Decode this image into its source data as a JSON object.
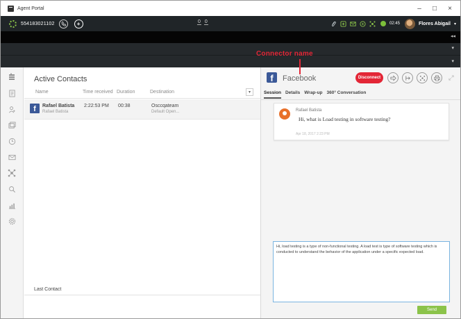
{
  "window": {
    "title": "Agent Portal",
    "controls": {
      "minimize": "–",
      "maximize": "□",
      "close": "×"
    }
  },
  "topbar": {
    "phone_number": "554183021102",
    "counter_left": "0",
    "counter_right": "0",
    "timer": "02:45",
    "user_name": "Flores Abigail",
    "status_color": "#7cbf3a"
  },
  "annotation": {
    "connector_name_label": "Connector name",
    "color": "#e32636"
  },
  "nav": {
    "items": [
      {
        "icon": "contacts-list-icon"
      },
      {
        "icon": "notes-icon"
      },
      {
        "icon": "users-icon"
      },
      {
        "icon": "directory-icon"
      },
      {
        "icon": "history-clock-icon"
      },
      {
        "icon": "mail-icon"
      },
      {
        "icon": "network-icon"
      },
      {
        "icon": "search-icon"
      },
      {
        "icon": "reports-chart-icon"
      },
      {
        "icon": "settings-gear-icon"
      }
    ]
  },
  "contacts": {
    "heading": "Active Contacts",
    "columns": {
      "name": "Name",
      "time": "Time received",
      "duration": "Duration",
      "destination": "Destination"
    },
    "rows": [
      {
        "name": "Rafael Batista",
        "sub": "Rafael Batista",
        "time": "2:22:53 PM",
        "duration": "00:38",
        "destination": "Osccqateam",
        "destination_sub": "Default Open..."
      }
    ],
    "last_contact_label": "Last Contact"
  },
  "session": {
    "connector_name": "Facebook",
    "disconnect_label": "Disconnect",
    "tabs": [
      "Session",
      "Details",
      "Wrap-up",
      "360° Conversation"
    ],
    "active_tab": "Session",
    "message": {
      "sender": "Rafael Batista",
      "text": "Hi, what is Load testing in software testing?",
      "timestamp": "Apr 18, 2017 2:23 PM"
    },
    "reply_text": "Hi, load testing is a type of non-functional testing. A load test is type of software testing which is conducted to understand the behavior of the application under a specific expected load.",
    "send_label": "Send",
    "brand_color": "#3b5998",
    "accent_color": "#e32636",
    "send_color": "#8bc34a"
  }
}
